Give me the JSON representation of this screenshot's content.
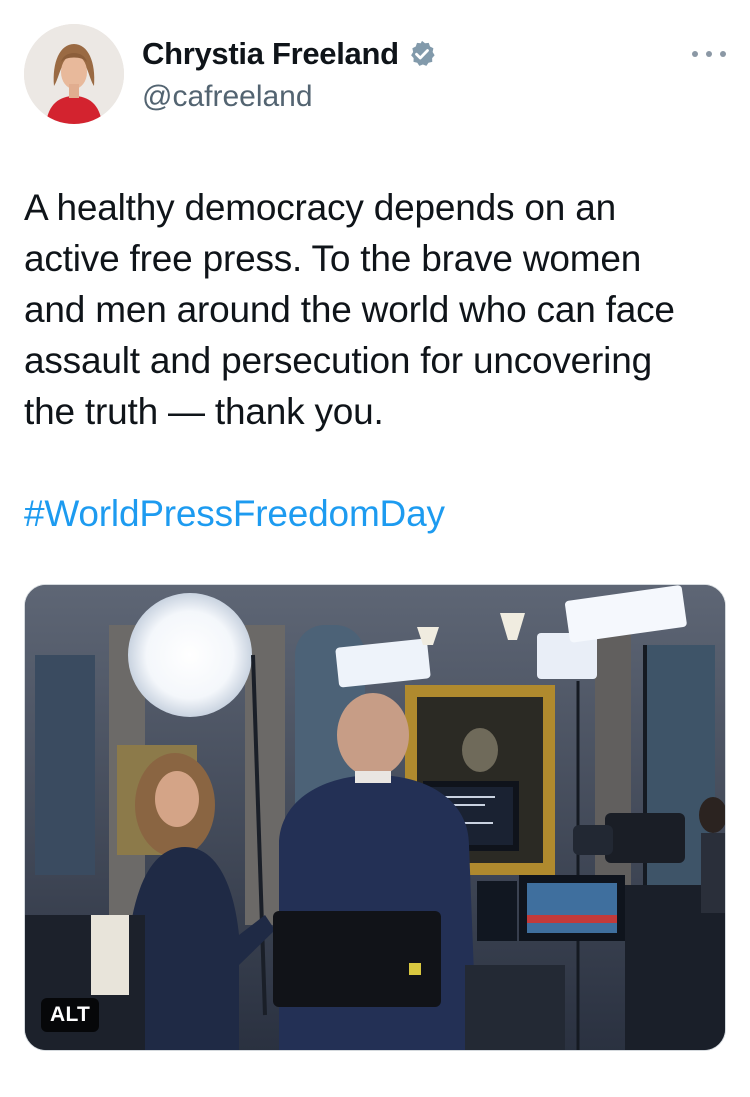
{
  "author": {
    "display_name": "Chrystia Freeland",
    "handle": "@cafreeland",
    "avatar_icon": "profile-photo",
    "verified_icon": "verified-badge-icon",
    "verified_color": "#829aab"
  },
  "more_icon": "more-options-icon",
  "tweet": {
    "lines": [
      "A healthy democracy depends on an",
      "active free press. To the brave women",
      "and men around the world who can face",
      "assault and persecution for uncovering",
      "the truth — thank you."
    ],
    "hashtag": "#WorldPressFreedomDay",
    "hashtag_color": "#1d9bf0"
  },
  "media": {
    "alt_label": "ALT"
  }
}
